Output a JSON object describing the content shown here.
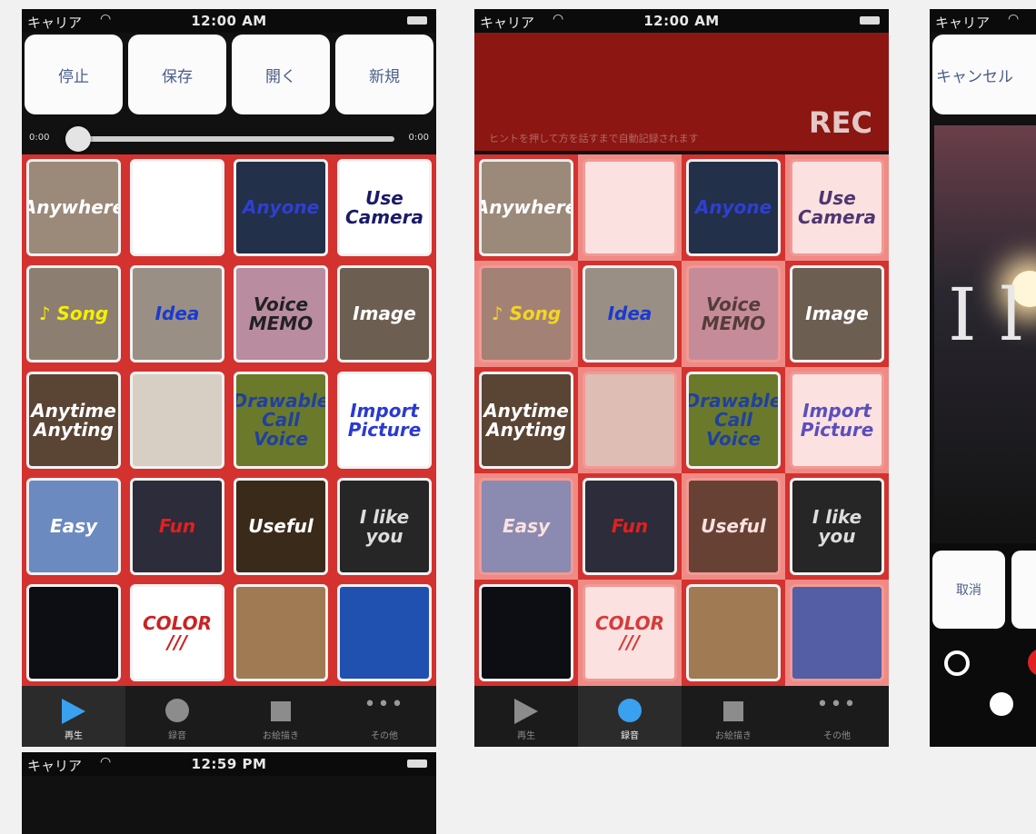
{
  "status": {
    "carrier": "キャリア",
    "time1": "12:00 AM",
    "time2": "12:00 AM",
    "time4": "12:59 PM"
  },
  "toolbar": [
    "停止",
    "保存",
    "開く",
    "新規"
  ],
  "slider": {
    "current": "0:00",
    "total": "0:00"
  },
  "rec": {
    "label": "REC",
    "hint": "ヒントを押して方を話すまで自動記録されます"
  },
  "tiles": [
    {
      "label": "Anywhere",
      "bg": "#9b8a7a",
      "fg": "#ffffff"
    },
    {
      "label": "",
      "bg": "#ffffff",
      "fg": "#000000"
    },
    {
      "label": "Anyone",
      "bg": "#22304a",
      "fg": "#2f3fd0"
    },
    {
      "label": "Use Camera",
      "bg": "#ffffff",
      "fg": "#1a1a6a"
    },
    {
      "label": "♪ Song",
      "bg": "#8c7e70",
      "fg": "#f4f000"
    },
    {
      "label": "Idea",
      "bg": "#9a8f84",
      "fg": "#1a3ad0"
    },
    {
      "label": "Voice MEMO",
      "bg": "#b98ca0",
      "fg": "#222222"
    },
    {
      "label": "Image",
      "bg": "#6d5e52",
      "fg": "#ffffff"
    },
    {
      "label": "Anytime Anyting",
      "bg": "#5a4434",
      "fg": "#ffffff"
    },
    {
      "label": "",
      "bg": "#d8cfc4",
      "fg": "#666666"
    },
    {
      "label": "Drawable Call Voice",
      "bg": "#6a7a2a",
      "fg": "#2040a0"
    },
    {
      "label": "Import Picture",
      "bg": "#ffffff",
      "fg": "#2a3ad0"
    },
    {
      "label": "Easy",
      "bg": "#6a8ac0",
      "fg": "#ffffff"
    },
    {
      "label": "Fun",
      "bg": "#2c2c3a",
      "fg": "#e02020"
    },
    {
      "label": "Useful",
      "bg": "#3a2a1a",
      "fg": "#ffffff"
    },
    {
      "label": "I like you",
      "bg": "#262626",
      "fg": "#dddddd"
    },
    {
      "label": "",
      "bg": "#0d0d14",
      "fg": "#ffffff"
    },
    {
      "label": "COLOR ///",
      "bg": "#ffffff",
      "fg": "#cc2222"
    },
    {
      "label": "",
      "bg": "#a07a52",
      "fg": "#ffffff"
    },
    {
      "label": "",
      "bg": "#2050b0",
      "fg": "#ffffff"
    }
  ],
  "tabs": [
    {
      "label": "再生",
      "icon": "play-icon"
    },
    {
      "label": "録音",
      "icon": "record-icon"
    },
    {
      "label": "お絵描き",
      "icon": "draw-icon"
    },
    {
      "label": "その他",
      "icon": "more-icon"
    }
  ],
  "phone3": {
    "cancel": "キャンセル",
    "torikeshi": "取消",
    "big_text": "I l"
  }
}
